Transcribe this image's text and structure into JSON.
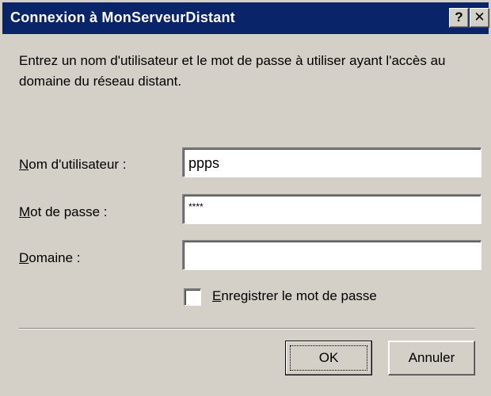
{
  "dialog": {
    "title": "Connexion à MonServeurDistant",
    "help_label": "?",
    "close_label": "✕",
    "intro_text": "Entrez un nom d'utilisateur et le mot de passe à utiliser ayant l'accès au domaine du réseau distant."
  },
  "form": {
    "username": {
      "label_accel": "N",
      "label_rest": "om d'utilisateur :",
      "value": "ppps"
    },
    "password": {
      "label_accel": "M",
      "label_rest": "ot de passe :",
      "value": "****"
    },
    "domain": {
      "label_accel": "D",
      "label_rest": "omaine :",
      "value": ""
    },
    "save_password": {
      "label_accel": "E",
      "label_rest": "nregistrer le mot de passe",
      "checked": false
    }
  },
  "buttons": {
    "ok_label": "OK",
    "cancel_label": "Annuler"
  },
  "colors": {
    "title_bar": "#0a246a",
    "face": "#d4d0c8",
    "field_bg": "#ffffff"
  }
}
